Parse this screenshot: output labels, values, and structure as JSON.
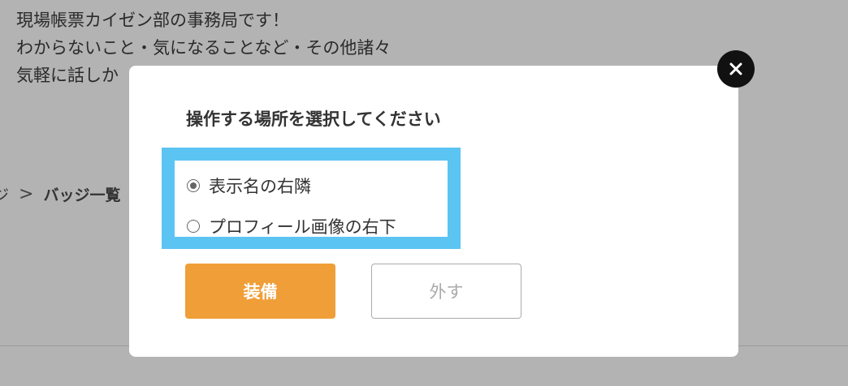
{
  "background": {
    "intro_lines": [
      "現場帳票カイゼン部の事務局です！",
      "わからないこと・気になることなど・その他諸々",
      "気軽に話しか"
    ],
    "breadcrumb": {
      "prev_fragment": "ジ",
      "separator": ">",
      "current": "バッジ一覧"
    }
  },
  "modal": {
    "title": "操作する場所を選択してください",
    "options": [
      {
        "label": "表示名の右隣",
        "selected": true
      },
      {
        "label": "プロフィール画像の右下",
        "selected": false
      }
    ],
    "buttons": {
      "equip_label": "装備",
      "remove_label": "外す"
    },
    "close_icon": "close-icon"
  },
  "colors": {
    "overlay": "#b3b3b3",
    "highlight": "#5bc4f2",
    "equip_button": "#f09e37",
    "close_button": "#111111"
  }
}
